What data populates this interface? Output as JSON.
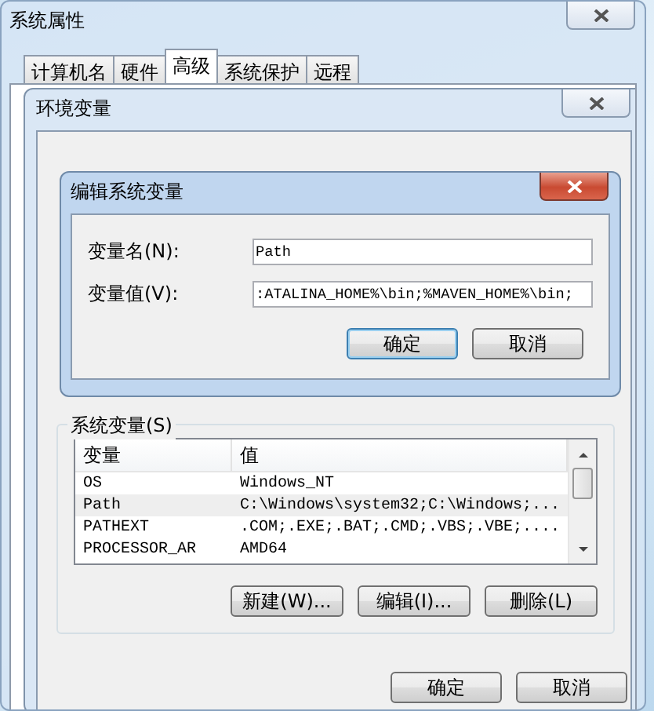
{
  "window": {
    "title": "系统属性"
  },
  "tabs": [
    {
      "label": "计算机名",
      "selected": false
    },
    {
      "label": "硬件",
      "selected": false
    },
    {
      "label": "高级",
      "selected": true
    },
    {
      "label": "系统保护",
      "selected": false
    },
    {
      "label": "远程",
      "selected": false
    }
  ],
  "environment_dialog": {
    "title": "环境变量",
    "system_variables": {
      "label": "系统变量(S)",
      "columns": [
        "变量",
        "值"
      ],
      "rows": [
        {
          "cells": [
            "OS",
            "Windows_NT"
          ],
          "selected": false
        },
        {
          "cells": [
            "Path",
            "C:\\Windows\\system32;C:\\Windows;..."
          ],
          "selected": true
        },
        {
          "cells": [
            "PATHEXT",
            ".COM;.EXE;.BAT;.CMD;.VBS;.VBE;...."
          ],
          "selected": false
        },
        {
          "cells": [
            "PROCESSOR_AR",
            "AMD64"
          ],
          "selected": false
        }
      ],
      "buttons": [
        "新建(W)...",
        "编辑(I)...",
        "删除(L)"
      ]
    },
    "buttons": [
      "确定",
      "取消"
    ]
  },
  "edit_dialog": {
    "title": "编辑系统变量",
    "fields": [
      {
        "label": "变量名(N):",
        "value": "Path"
      },
      {
        "label": "变量值(V):",
        "value": ":ATALINA_HOME%\\bin;%MAVEN_HOME%\\bin;"
      }
    ],
    "buttons": [
      "确定",
      "取消"
    ]
  }
}
